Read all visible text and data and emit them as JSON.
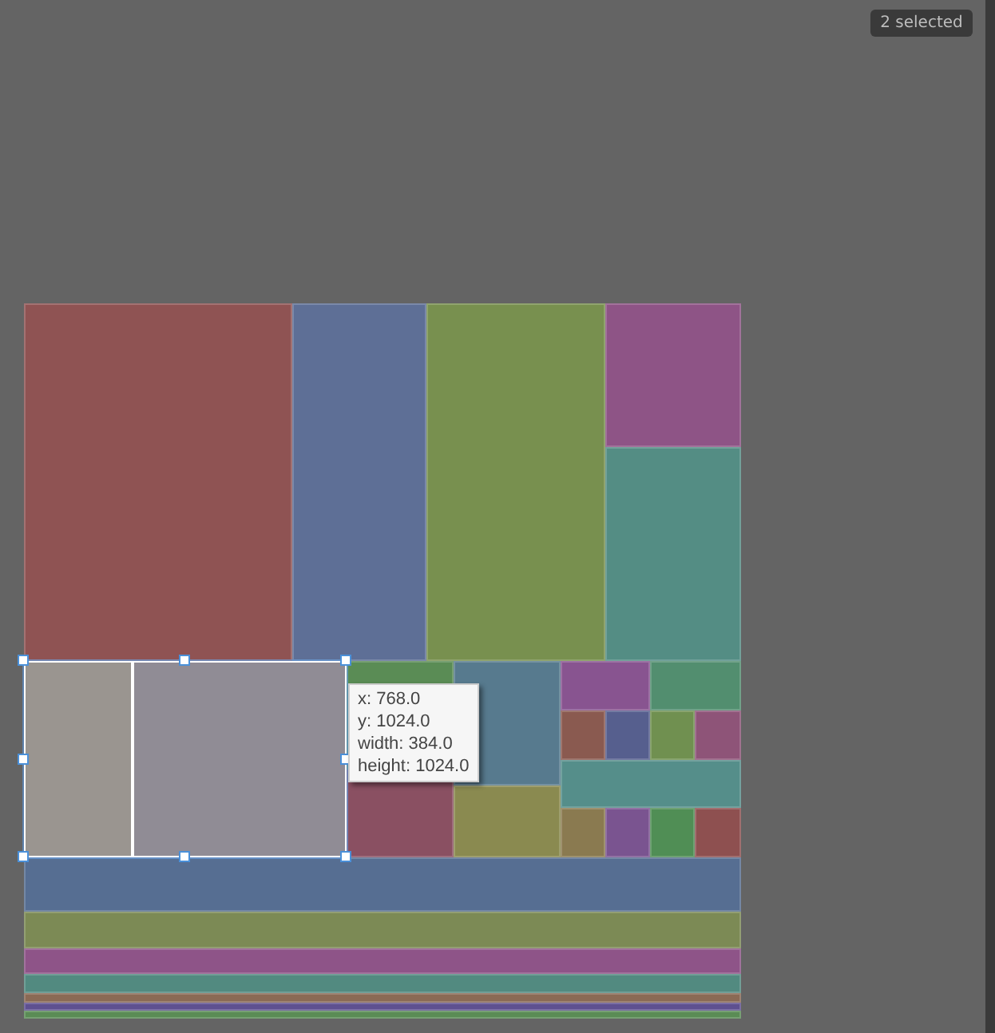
{
  "badge": "2 selected",
  "regions": [
    {
      "color": "#8f5353",
      "selected": false
    },
    {
      "color": "#5e6f96",
      "selected": false
    },
    {
      "color": "#78904f",
      "selected": false
    },
    {
      "color": "#8e5486",
      "selected": false
    },
    {
      "color": "#548d84",
      "selected": false
    },
    {
      "color": "#9a9590",
      "selected": true
    },
    {
      "color": "#908c95",
      "selected": true
    },
    {
      "color": "#5a8c55",
      "selected": false
    },
    {
      "color": "#8a5062",
      "selected": false
    },
    {
      "color": "#577a8e",
      "selected": false
    },
    {
      "color": "#8a8a50",
      "selected": false
    },
    {
      "color": "#885490",
      "selected": false
    },
    {
      "color": "#528e6f",
      "selected": false
    },
    {
      "color": "#8a5a50",
      "selected": false
    },
    {
      "color": "#565f8e",
      "selected": false
    },
    {
      "color": "#709050",
      "selected": false
    },
    {
      "color": "#8e5478",
      "selected": false
    },
    {
      "color": "#558e8a",
      "selected": false
    },
    {
      "color": "#8a7a50",
      "selected": false
    },
    {
      "color": "#7a5490",
      "selected": false
    },
    {
      "color": "#508e55",
      "selected": false
    },
    {
      "color": "#8e5050",
      "selected": false
    },
    {
      "color": "#566e92",
      "selected": false
    },
    {
      "color": "#7c8a55",
      "selected": false
    },
    {
      "color": "#8e5488",
      "selected": false
    },
    {
      "color": "#528a80",
      "selected": false
    },
    {
      "color": "#8a6a55",
      "selected": false
    },
    {
      "color": "#5e5090",
      "selected": false
    },
    {
      "color": "#5a8c55",
      "selected": false
    }
  ],
  "tooltip": [
    "x: 768.0",
    "y: 1024.0",
    "width: 384.0",
    "height: 1024.0"
  ]
}
